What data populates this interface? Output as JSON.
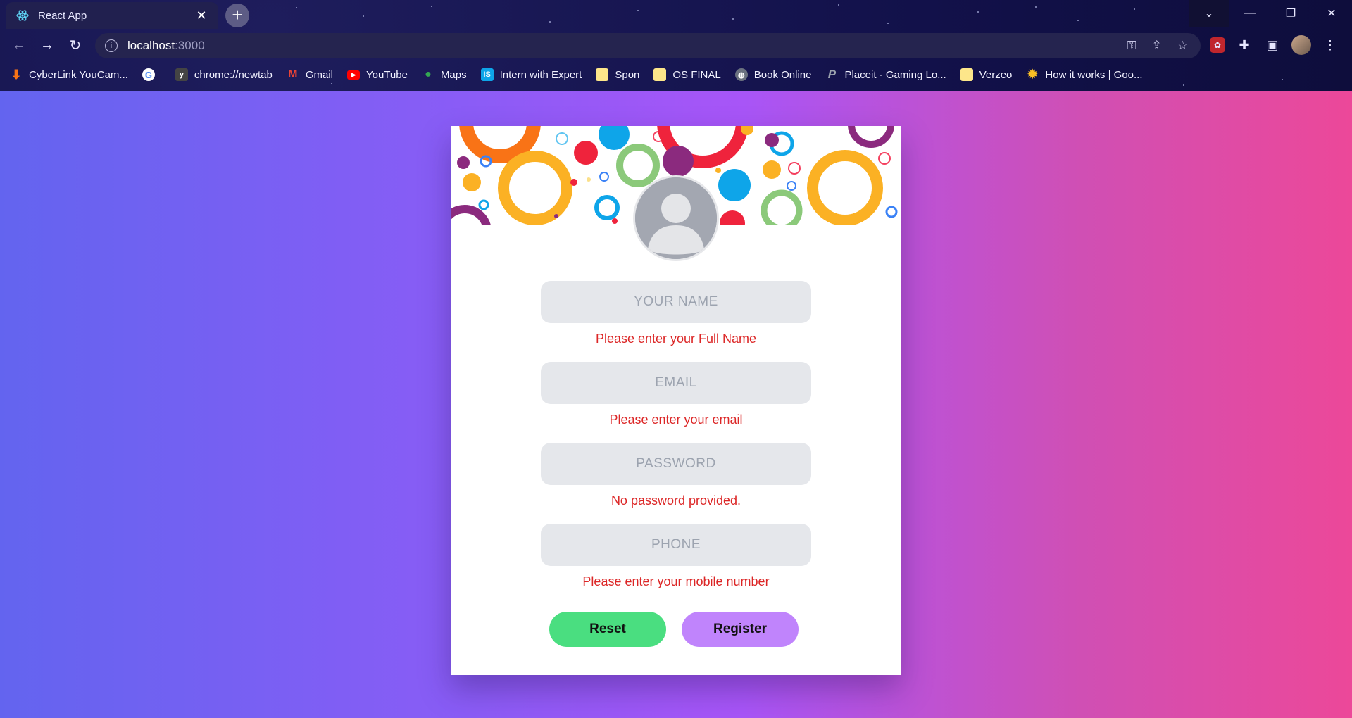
{
  "browser": {
    "tab_title": "React App",
    "url_host": "localhost",
    "url_port": ":3000",
    "bookmarks": [
      {
        "label": "CyberLink YouCam...",
        "icon": "download-arrow-icon",
        "color": "#f97316"
      },
      {
        "label": "",
        "icon": "google-icon",
        "color": "#ffffff"
      },
      {
        "label": "chrome://newtab",
        "icon": "newtab-icon",
        "color": "#ffffff"
      },
      {
        "label": "Gmail",
        "icon": "gmail-icon",
        "color": "#ea4335"
      },
      {
        "label": "YouTube",
        "icon": "youtube-icon",
        "color": "#ff0000"
      },
      {
        "label": "Maps",
        "icon": "maps-pin-icon",
        "color": "#34a853"
      },
      {
        "label": "Intern with Expert",
        "icon": "is-icon",
        "color": "#0ea5e9"
      },
      {
        "label": "Spon",
        "icon": "folder-icon",
        "color": "#fde68a"
      },
      {
        "label": "OS FINAL",
        "icon": "folder-icon",
        "color": "#fde68a"
      },
      {
        "label": "Book Online",
        "icon": "globe-icon",
        "color": "#9ca3af"
      },
      {
        "label": "Placeit - Gaming Lo...",
        "icon": "placeit-icon",
        "color": "#9ca3af"
      },
      {
        "label": "Verzeo",
        "icon": "folder-icon",
        "color": "#fde68a"
      },
      {
        "label": "How it works | Goo...",
        "icon": "sun-icon",
        "color": "#fbbf24"
      }
    ]
  },
  "form": {
    "name_placeholder": "YOUR NAME",
    "name_error": "Please enter your Full Name",
    "email_placeholder": "EMAIL",
    "email_error": "Please enter your email",
    "password_placeholder": "PASSWORD",
    "password_error": "No password provided.",
    "phone_placeholder": "PHONE",
    "phone_error": "Please enter your mobile number",
    "reset_label": "Reset",
    "register_label": "Register"
  },
  "colors": {
    "page_gradient_start": "#6364ef",
    "page_gradient_end": "#ec4899",
    "error_text": "#dc2626",
    "reset_button": "#4ade80",
    "register_button": "#c084fc",
    "field_bg": "#e5e7eb"
  }
}
